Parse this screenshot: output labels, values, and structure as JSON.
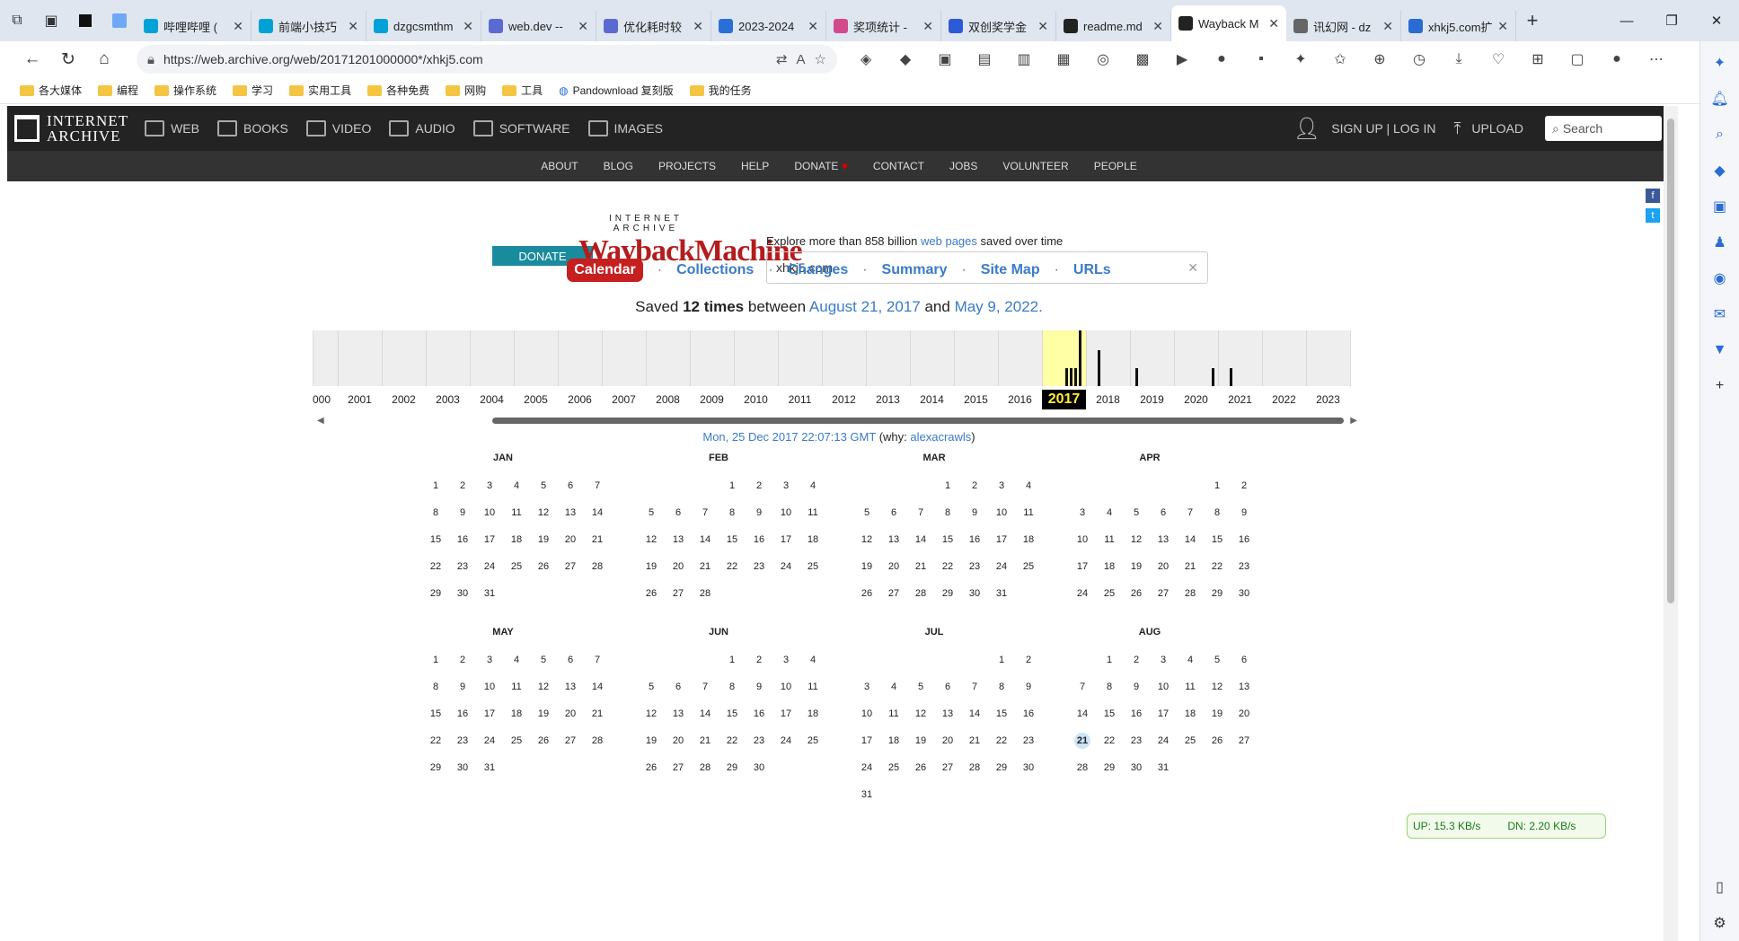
{
  "tabs": [
    {
      "title": "哔哩哔哩 (",
      "color": "#00a1d6"
    },
    {
      "title": "前端小技巧",
      "color": "#00a1d6"
    },
    {
      "title": "dzgcsmthm",
      "color": "#00a1d6"
    },
    {
      "title": "web.dev --",
      "color": "#5b6ad0"
    },
    {
      "title": "优化耗时较",
      "color": "#5b6ad0"
    },
    {
      "title": "2023-2024",
      "color": "#2a6fd6"
    },
    {
      "title": "奖项统计 - ",
      "color": "#d24a8c"
    },
    {
      "title": "双创奖学金",
      "color": "#2b5bd7"
    },
    {
      "title": "readme.md",
      "color": "#222222"
    },
    {
      "title": "Wayback M",
      "color": "#222222",
      "active": true
    },
    {
      "title": "讯幻网 - dz",
      "color": "#666666"
    },
    {
      "title": "xhkj5.com扩",
      "color": "#2b6cd4"
    }
  ],
  "address": {
    "url": "https://web.archive.org/web/20171201000000*/xhkj5.com"
  },
  "bookmarks": [
    "各大媒体",
    "编程",
    "操作系统",
    "学习",
    "实用工具",
    "各种免费",
    "网购",
    "工具",
    "Pandownload 复刻版",
    "我的任务"
  ],
  "ia": {
    "logo_line1": "INTERNET",
    "logo_line2": "ARCHIVE",
    "nav": [
      "WEB",
      "BOOKS",
      "VIDEO",
      "AUDIO",
      "SOFTWARE",
      "IMAGES"
    ],
    "signup": "SIGN UP | LOG IN",
    "upload": "UPLOAD",
    "search_placeholder": "Search",
    "subnav": [
      "ABOUT",
      "BLOG",
      "PROJECTS",
      "HELP",
      "DONATE",
      "CONTACT",
      "JOBS",
      "VOLUNTEER",
      "PEOPLE"
    ]
  },
  "wayback": {
    "donate": "DONATE",
    "logo_small": "INTERNET ARCHIVE",
    "logo_big": "WaybackMachine",
    "explore_pre": "Explore more than 858 billion ",
    "explore_link": "web pages",
    "explore_post": " saved over time",
    "query": "xhkj5.com",
    "tabs": [
      "Calendar",
      "Collections",
      "Changes",
      "Summary",
      "Site Map",
      "URLs"
    ],
    "saved_pre": "Saved ",
    "saved_count": "12 times",
    "saved_mid": " between ",
    "saved_from": "August 21, 2017",
    "saved_and": " and ",
    "saved_to": "May 9, 2022.",
    "years": [
      "000",
      "2001",
      "2002",
      "2003",
      "2004",
      "2005",
      "2006",
      "2007",
      "2008",
      "2009",
      "2010",
      "2011",
      "2012",
      "2013",
      "2014",
      "2015",
      "2016",
      "2017",
      "2018",
      "2019",
      "2020",
      "2021",
      "2022",
      "2023"
    ],
    "selected_year": "2017",
    "capture_date": "Mon, 25 Dec 2017 22:07:13 GMT",
    "capture_why_pre": " (why: ",
    "capture_why": "alexacrawls",
    "capture_why_post": ")"
  },
  "calendar": [
    {
      "name": "JAN",
      "start": 1,
      "days": 31
    },
    {
      "name": "FEB",
      "start": 4,
      "days": 28
    },
    {
      "name": "MAR",
      "start": 4,
      "days": 31
    },
    {
      "name": "APR",
      "start": 6,
      "days": 30
    },
    {
      "name": "MAY",
      "start": 1,
      "days": 31
    },
    {
      "name": "JUN",
      "start": 4,
      "days": 30
    },
    {
      "name": "JUL",
      "start": 6,
      "days": 31
    },
    {
      "name": "AUG",
      "start": 2,
      "days": 31,
      "snapshot_day": 21
    }
  ],
  "netmon": {
    "up": "UP: 15.3 KB/s",
    "dn": "DN: 2.20 KB/s"
  }
}
